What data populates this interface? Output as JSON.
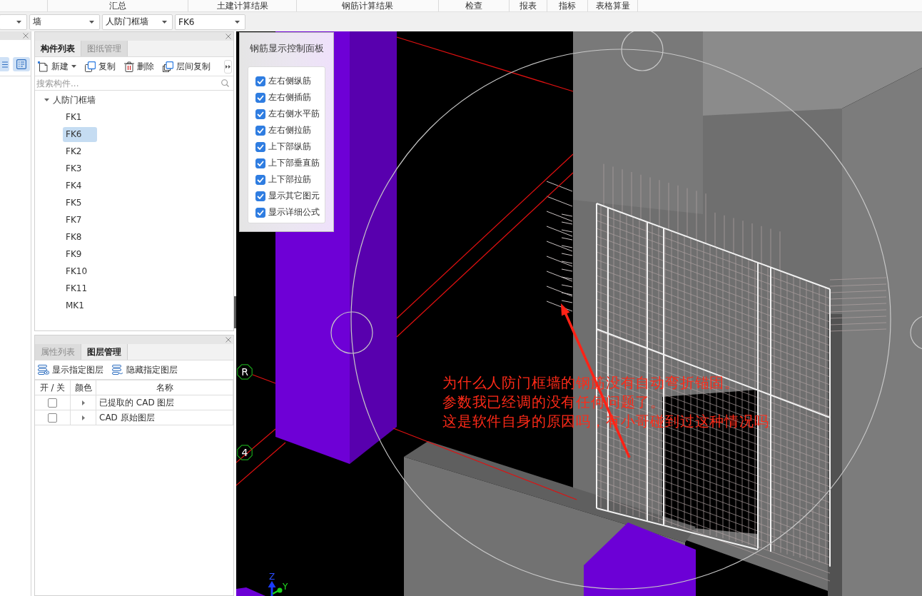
{
  "ribbon_tabs": [
    {
      "label": "汇总"
    },
    {
      "label": "土建计算结果"
    },
    {
      "label": "钢筋计算结果"
    },
    {
      "label": "检查"
    },
    {
      "label": "报表"
    },
    {
      "label": "指标"
    },
    {
      "label": "表格算量"
    }
  ],
  "selectors": [
    {
      "value": "墙"
    },
    {
      "value": "人防门框墙"
    },
    {
      "value": "FK6"
    }
  ],
  "component_panel": {
    "tabs": [
      {
        "label": "构件列表",
        "selected": true
      },
      {
        "label": "图纸管理",
        "selected": false
      }
    ],
    "toolbar": [
      {
        "label": "新建",
        "has_menu": true
      },
      {
        "label": "复制",
        "has_menu": false
      },
      {
        "label": "删除",
        "has_menu": false
      },
      {
        "label": "层间复制",
        "has_menu": false
      }
    ],
    "search": {
      "placeholder": "搜索构件..."
    },
    "tree": [
      {
        "label": "人防门框墙",
        "expanded": true,
        "selected": false,
        "children": [
          {
            "label": "FK1",
            "selected": false
          },
          {
            "label": "FK6",
            "selected": true
          },
          {
            "label": "FK2",
            "selected": false
          },
          {
            "label": "FK3",
            "selected": false
          },
          {
            "label": "FK4",
            "selected": false
          },
          {
            "label": "FK5",
            "selected": false
          },
          {
            "label": "FK7",
            "selected": false
          },
          {
            "label": "FK8",
            "selected": false
          },
          {
            "label": "FK9",
            "selected": false
          },
          {
            "label": "FK10",
            "selected": false
          },
          {
            "label": "FK11",
            "selected": false
          },
          {
            "label": "MK1",
            "selected": false
          }
        ]
      }
    ]
  },
  "layer_panel": {
    "tabs": [
      {
        "label": "属性列表",
        "selected": false
      },
      {
        "label": "图层管理",
        "selected": true
      }
    ],
    "toolbar": [
      {
        "label": "显示指定图层"
      },
      {
        "label": "隐藏指定图层"
      }
    ],
    "columns": [
      "开 / 关",
      "颜色",
      "名称"
    ],
    "rows": [
      {
        "checked": false,
        "expanded": false,
        "name": "已提取的 CAD 图层"
      },
      {
        "checked": false,
        "expanded": false,
        "name": "CAD 原始图层"
      }
    ]
  },
  "viewport": {
    "control_panel": {
      "title": "钢筋显示控制面板",
      "options": [
        {
          "label": "左右侧纵筋",
          "checked": true
        },
        {
          "label": "左右侧插筋",
          "checked": true
        },
        {
          "label": "左右侧水平筋",
          "checked": true
        },
        {
          "label": "左右侧拉筋",
          "checked": true
        },
        {
          "label": "上下部纵筋",
          "checked": true
        },
        {
          "label": "上下部垂直筋",
          "checked": true
        },
        {
          "label": "上下部拉筋",
          "checked": true
        },
        {
          "label": "显示其它图元",
          "checked": true
        },
        {
          "label": "显示详细公式",
          "checked": true
        }
      ]
    },
    "axis_markers": [
      {
        "label": "R"
      },
      {
        "label": "4"
      }
    ],
    "gizmo_axes": [
      {
        "label": "Z"
      },
      {
        "label": "Y"
      }
    ],
    "annotation": {
      "lines": [
        "为什么人防门框墙的钢筋没有自动弯折锚固。",
        "参数我已经调的没有任何问题了。",
        "这是软件自身的原因吗，有小哥碰到过这种情况吗"
      ]
    }
  }
}
